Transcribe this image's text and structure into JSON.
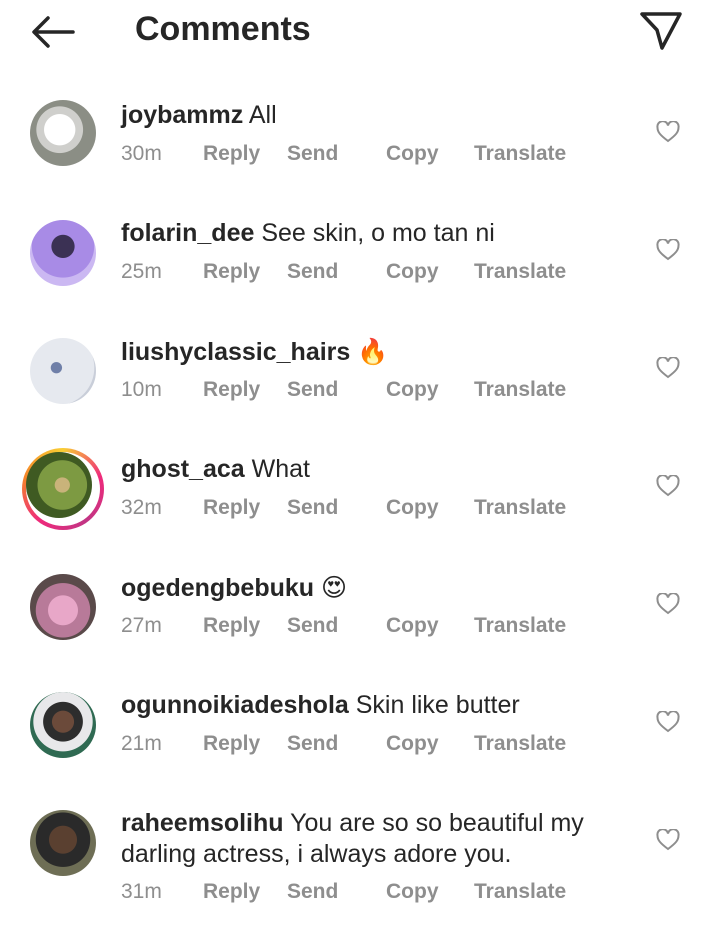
{
  "header": {
    "title": "Comments"
  },
  "comments": [
    {
      "username": "joybammz",
      "text": "All",
      "time": "30m",
      "avatar_color": "#9a9a90"
    },
    {
      "username": "folarin_dee",
      "text": "See skin, o mo tan ni",
      "time": "25m",
      "avatar_color": "#8a63d2"
    },
    {
      "username": "liushyclassic_hairs",
      "text": "🔥",
      "time": "10m",
      "avatar_color": "#e9ecf2"
    },
    {
      "username": "ghost_aca",
      "text": "What",
      "time": "32m",
      "avatar_color": "#6f8a3a"
    },
    {
      "username": "ogedengbebuku",
      "text": "😍",
      "time": "27m",
      "avatar_color": "#c48aa8"
    },
    {
      "username": "ogunnoikiadeshola",
      "text": "Skin like butter",
      "time": "21m",
      "avatar_color": "#3a5a4a"
    },
    {
      "username": "raheemsolihu",
      "text": "You are so so beautiful my darling actress, i always adore you.",
      "time": "31m",
      "avatar_color": "#4a4a3a"
    }
  ],
  "actions": {
    "reply": "Reply",
    "send": "Send",
    "copy": "Copy",
    "translate": "Translate"
  },
  "icons": {
    "back": "arrow-left-icon",
    "send": "paper-plane-icon",
    "like": "heart-icon"
  },
  "colors": {
    "text": "#262626",
    "meta": "#8e8e8e"
  }
}
